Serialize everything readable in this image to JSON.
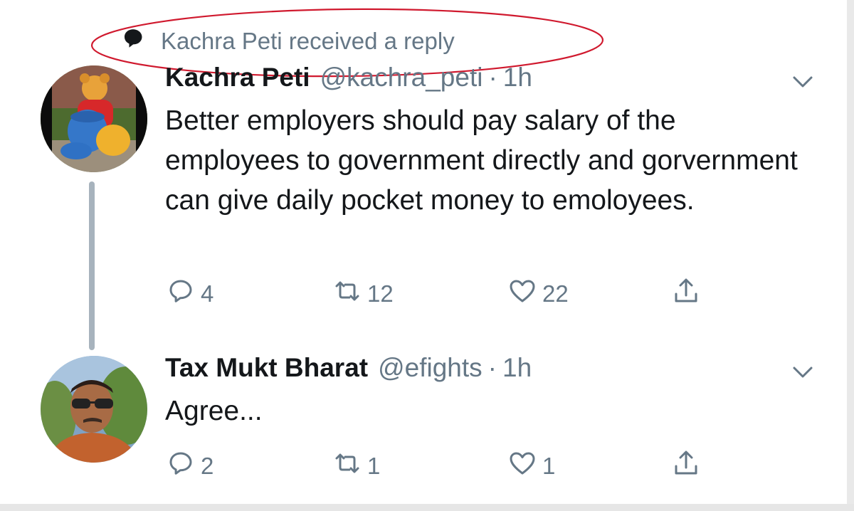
{
  "context": {
    "label": "Kachra Peti received a reply",
    "icon": "speech-bubble-icon"
  },
  "annotation": {
    "color": "#d0192e"
  },
  "colors": {
    "text": "#14171a",
    "secondary": "#657786",
    "thread_line": "#a7b3bd"
  },
  "tweets": [
    {
      "name": "Kachra Peti",
      "handle": "@kachra_peti",
      "dot": "·",
      "time": "1h",
      "text": "Better employers should pay salary of the employees to government directly  and gorvernment can give daily pocket money to emoloyees.",
      "replies": "4",
      "retweets": "12",
      "likes": "22",
      "avatar": "pooh-statue-avatar"
    },
    {
      "name": "Tax Mukt Bharat",
      "handle": "@efights",
      "dot": "·",
      "time": "1h",
      "text": "Agree...",
      "replies": "2",
      "retweets": "1",
      "likes": "1",
      "avatar": "man-sunglasses-avatar"
    }
  ]
}
